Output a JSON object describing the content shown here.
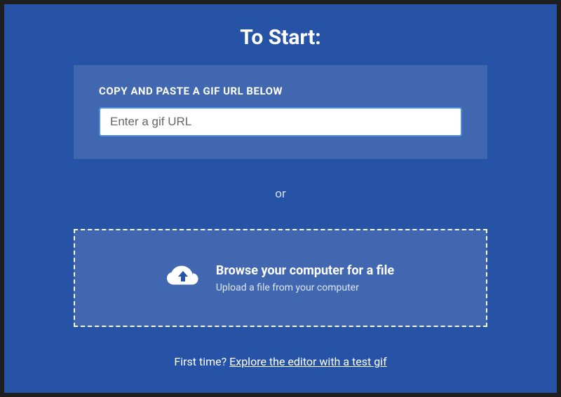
{
  "title": "To Start:",
  "url_section": {
    "label": "COPY AND PASTE A GIF URL BELOW",
    "placeholder": "Enter a gif URL"
  },
  "separator": "or",
  "upload_section": {
    "title": "Browse your computer for a file",
    "subtitle": "Upload a file from your computer"
  },
  "footer": {
    "prefix": "First time? ",
    "link": "Explore the editor with a test gif"
  }
}
